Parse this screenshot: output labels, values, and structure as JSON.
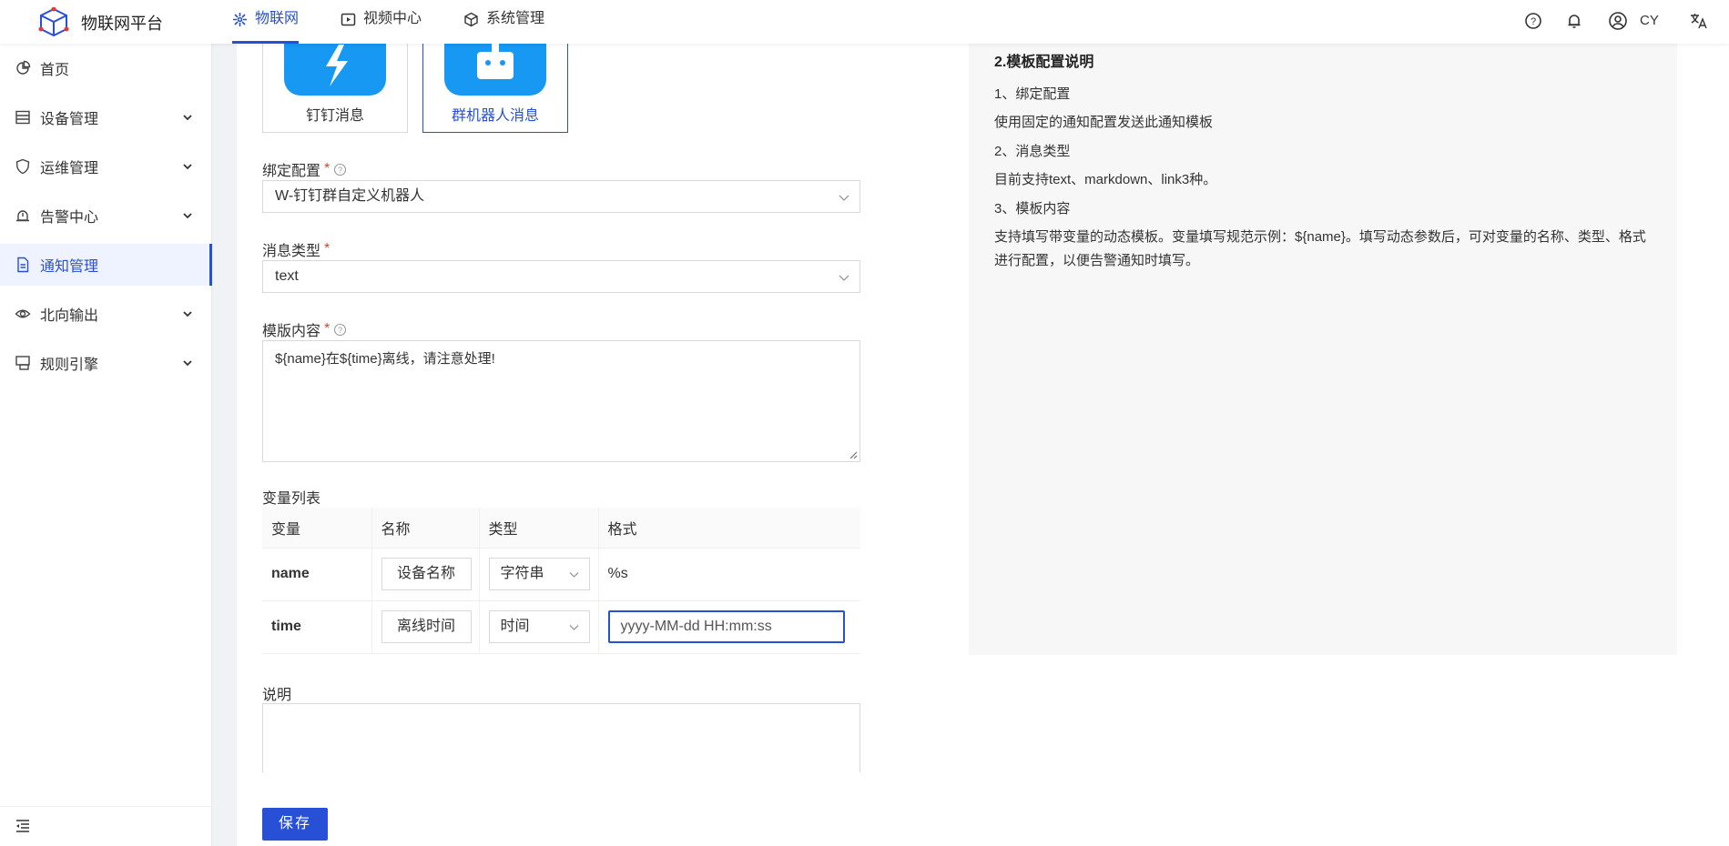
{
  "header": {
    "app_title": "物联网平台",
    "nav": [
      {
        "label": "物联网",
        "icon": "iot-icon",
        "active": true
      },
      {
        "label": "视频中心",
        "icon": "video-icon",
        "active": false
      },
      {
        "label": "系统管理",
        "icon": "cube-icon",
        "active": false
      }
    ],
    "user_name": "CY"
  },
  "sidebar": {
    "items": [
      {
        "label": "首页",
        "icon": "pie-icon",
        "active": false,
        "expandable": false
      },
      {
        "label": "设备管理",
        "icon": "list-icon",
        "active": false,
        "expandable": true
      },
      {
        "label": "运维管理",
        "icon": "shield-icon",
        "active": false,
        "expandable": true
      },
      {
        "label": "告警中心",
        "icon": "alarm-icon",
        "active": false,
        "expandable": true
      },
      {
        "label": "通知管理",
        "icon": "document-icon",
        "active": true,
        "expandable": false
      },
      {
        "label": "北向输出",
        "icon": "eye-icon",
        "active": false,
        "expandable": true
      },
      {
        "label": "规则引擎",
        "icon": "rule-icon",
        "active": false,
        "expandable": true
      }
    ]
  },
  "form": {
    "type_cards": [
      {
        "label": "钉钉消息",
        "selected": false
      },
      {
        "label": "群机器人消息",
        "selected": true
      }
    ],
    "binding": {
      "label": "绑定配置",
      "value": "W-钉钉群自定义机器人"
    },
    "message_type": {
      "label": "消息类型",
      "value": "text"
    },
    "template": {
      "label": "模版内容",
      "value": "${name}在${time}离线，请注意处理!"
    },
    "variables": {
      "label": "变量列表",
      "columns": [
        "变量",
        "名称",
        "类型",
        "格式"
      ],
      "rows": [
        {
          "var": "name",
          "name": "设备名称",
          "type": "字符串",
          "format": "%s"
        },
        {
          "var": "time",
          "name": "离线时间",
          "type": "时间",
          "format": "yyyy-MM-dd HH:mm:ss"
        }
      ]
    },
    "description": {
      "label": "说明",
      "value": ""
    },
    "save_label": "保存"
  },
  "help": {
    "title": "2.模板配置说明",
    "lines": [
      "1、绑定配置",
      "使用固定的通知配置发送此通知模板",
      "2、消息类型",
      "目前支持text、markdown、link3种。",
      "3、模板内容",
      "支持填写带变量的动态模板。变量填写规范示例：${name}。填写动态参数后，可对变量的名称、类型、格式进行配置，以便告警通知时填写。"
    ]
  },
  "colors": {
    "accent": "#2750d6",
    "card_blue": "#1798f2",
    "required": "#e53935"
  }
}
